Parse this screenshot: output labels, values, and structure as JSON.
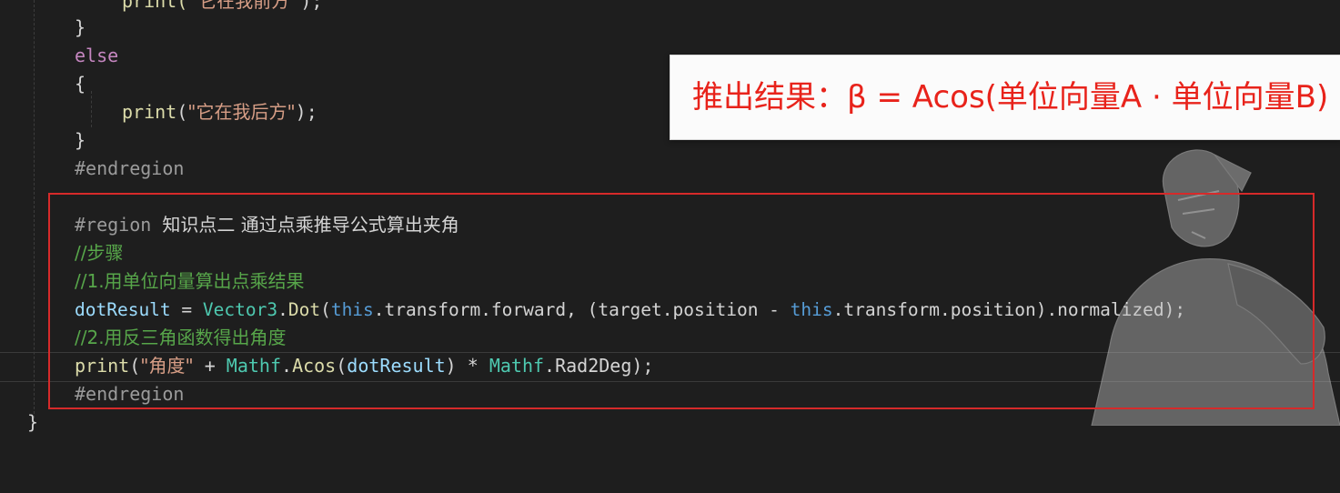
{
  "code": {
    "line1_prefix": "print(\"",
    "line1_str": "它在我前方",
    "line1_suffix": "\");",
    "brace_close": "}",
    "else_kw": "else",
    "brace_open": "{",
    "line2_fn": "print",
    "line2_open": "(",
    "line2_str": "\"它在我后方\"",
    "line2_close": ");",
    "endregion1": "#endregion",
    "region_kw": "#region",
    "region_title": "知识点二 通过点乘推导公式算出夹角",
    "comment1": "//步骤",
    "comment2": "//1.用单位向量算出点乘结果",
    "dot_line": {
      "var": "dotResult",
      "eq": " = ",
      "cls": "Vector3",
      "dot1": ".",
      "fn": "Dot",
      "p1": "(",
      "this1": "this",
      "rest1": ".transform.forward, (target.position - ",
      "this2": "this",
      "rest2": ".transform.position).normalized);"
    },
    "comment3": "//2.用反三角函数得出角度",
    "print_line": {
      "fn": "print",
      "p1": "(",
      "str": "\"角度\"",
      "plus": " + ",
      "cls1": "Mathf",
      "dot1": ".",
      "fn2": "Acos",
      "p2": "(",
      "var": "dotResult",
      "mul": ") * ",
      "cls2": "Mathf",
      "rest": ".Rad2Deg);"
    },
    "endregion2": "#endregion",
    "final_brace": "}"
  },
  "banner": {
    "text": "推出结果：β = Acos(单位向量A · 单位向量B)"
  },
  "colors": {
    "background": "#1e1e1e",
    "keyword": "#569cd6",
    "string": "#d69d85",
    "comment": "#57a64a",
    "highlight_border": "#d62a2a",
    "banner_text": "#e8231b"
  }
}
